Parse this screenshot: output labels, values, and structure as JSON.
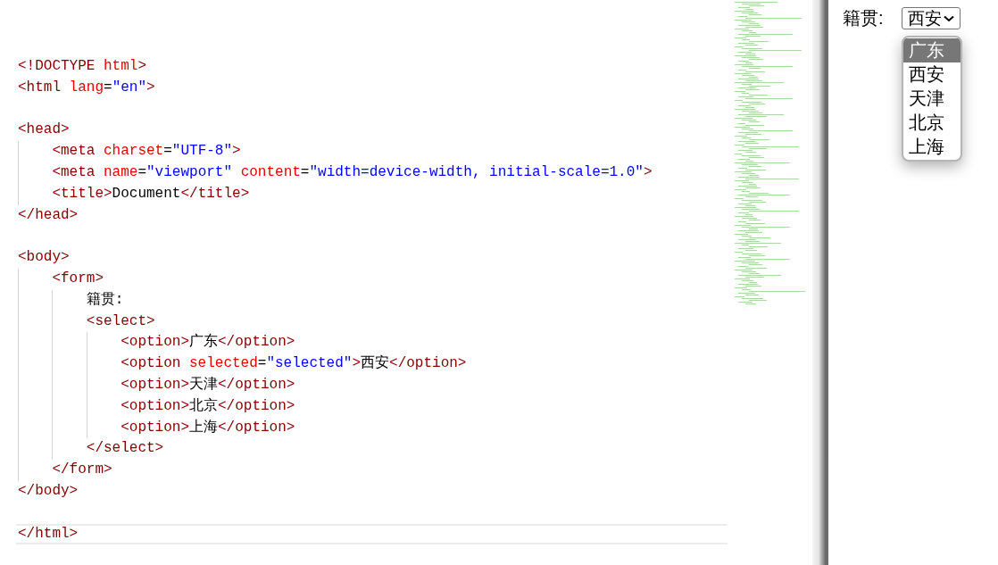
{
  "editor": {
    "lines": [
      {
        "kind": "code",
        "tokens": [
          {
            "kind": "tag",
            "t": "<!DOCTYPE "
          },
          {
            "kind": "attr",
            "t": "html"
          },
          {
            "kind": "tag",
            "t": ">"
          }
        ]
      },
      {
        "kind": "code",
        "tokens": [
          {
            "kind": "tag",
            "t": "<html "
          },
          {
            "kind": "attr",
            "t": "lang"
          },
          {
            "kind": "text",
            "t": "="
          },
          {
            "kind": "value",
            "t": "\"en\""
          },
          {
            "kind": "tag",
            "t": ">"
          }
        ]
      },
      {
        "kind": "blank"
      },
      {
        "kind": "code",
        "tokens": [
          {
            "kind": "tag",
            "t": "<head>"
          }
        ],
        "children": [
          {
            "kind": "code",
            "tokens": [
              {
                "kind": "tag",
                "t": "<meta "
              },
              {
                "kind": "attr",
                "t": "charset"
              },
              {
                "kind": "text",
                "t": "="
              },
              {
                "kind": "value",
                "t": "\"UTF-8\""
              },
              {
                "kind": "tag",
                "t": ">"
              }
            ]
          },
          {
            "kind": "code",
            "tokens": [
              {
                "kind": "tag",
                "t": "<meta "
              },
              {
                "kind": "attr",
                "t": "name"
              },
              {
                "kind": "text",
                "t": "="
              },
              {
                "kind": "value",
                "t": "\"viewport\""
              },
              {
                "kind": "attr",
                "t": " content"
              },
              {
                "kind": "text",
                "t": "="
              },
              {
                "kind": "value",
                "t": "\"width=device-width, initial-scale=1.0\""
              },
              {
                "kind": "tag",
                "t": ">"
              }
            ]
          },
          {
            "kind": "code",
            "tokens": [
              {
                "kind": "tag",
                "t": "<title>"
              },
              {
                "kind": "text",
                "t": "Document"
              },
              {
                "kind": "tag",
                "t": "</title>"
              }
            ]
          }
        ]
      },
      {
        "kind": "code",
        "tokens": [
          {
            "kind": "tag",
            "t": "</head>"
          }
        ]
      },
      {
        "kind": "blank"
      },
      {
        "kind": "code",
        "tokens": [
          {
            "kind": "tag",
            "t": "<body>"
          }
        ],
        "children": [
          {
            "kind": "code",
            "tokens": [
              {
                "kind": "tag",
                "t": "<form>"
              }
            ],
            "children": [
              {
                "kind": "code",
                "tokens": [
                  {
                    "kind": "text",
                    "t": "籍贯:"
                  }
                ]
              },
              {
                "kind": "code",
                "tokens": [
                  {
                    "kind": "tag",
                    "t": "<select>"
                  }
                ],
                "children": [
                  {
                    "kind": "code",
                    "tokens": [
                      {
                        "kind": "tag",
                        "t": "<option>"
                      },
                      {
                        "kind": "text",
                        "t": "广东"
                      },
                      {
                        "kind": "tag",
                        "t": "</option>"
                      }
                    ]
                  },
                  {
                    "kind": "code",
                    "tokens": [
                      {
                        "kind": "tag",
                        "t": "<option "
                      },
                      {
                        "kind": "attr",
                        "t": "selected"
                      },
                      {
                        "kind": "text",
                        "t": "="
                      },
                      {
                        "kind": "value",
                        "t": "\"selected\""
                      },
                      {
                        "kind": "tag",
                        "t": ">"
                      },
                      {
                        "kind": "text",
                        "t": "西安"
                      },
                      {
                        "kind": "tag",
                        "t": "</option>"
                      }
                    ]
                  },
                  {
                    "kind": "code",
                    "tokens": [
                      {
                        "kind": "tag",
                        "t": "<option>"
                      },
                      {
                        "kind": "text",
                        "t": "天津"
                      },
                      {
                        "kind": "tag",
                        "t": "</option>"
                      }
                    ]
                  },
                  {
                    "kind": "code",
                    "tokens": [
                      {
                        "kind": "tag",
                        "t": "<option>"
                      },
                      {
                        "kind": "text",
                        "t": "北京"
                      },
                      {
                        "kind": "tag",
                        "t": "</option>"
                      }
                    ]
                  },
                  {
                    "kind": "code",
                    "tokens": [
                      {
                        "kind": "tag",
                        "t": "<option>"
                      },
                      {
                        "kind": "text",
                        "t": "上海"
                      },
                      {
                        "kind": "tag",
                        "t": "</option>"
                      }
                    ]
                  }
                ]
              },
              {
                "kind": "code",
                "tokens": [
                  {
                    "kind": "tag",
                    "t": "</select>"
                  }
                ]
              }
            ]
          },
          {
            "kind": "code",
            "tokens": [
              {
                "kind": "tag",
                "t": "</form>"
              }
            ]
          }
        ]
      },
      {
        "kind": "code",
        "tokens": [
          {
            "kind": "tag",
            "t": "</body>"
          }
        ]
      },
      {
        "kind": "blank"
      },
      {
        "kind": "code",
        "tokens": [
          {
            "kind": "tag",
            "t": "</html>"
          }
        ],
        "current": true
      }
    ]
  },
  "preview": {
    "label": "籍贯:",
    "select": {
      "value": "西安",
      "options": [
        {
          "label": "广东",
          "highlighted": true
        },
        {
          "label": "西安",
          "highlighted": false
        },
        {
          "label": "天津",
          "highlighted": false
        },
        {
          "label": "北京",
          "highlighted": false
        },
        {
          "label": "上海",
          "highlighted": false
        }
      ]
    }
  }
}
